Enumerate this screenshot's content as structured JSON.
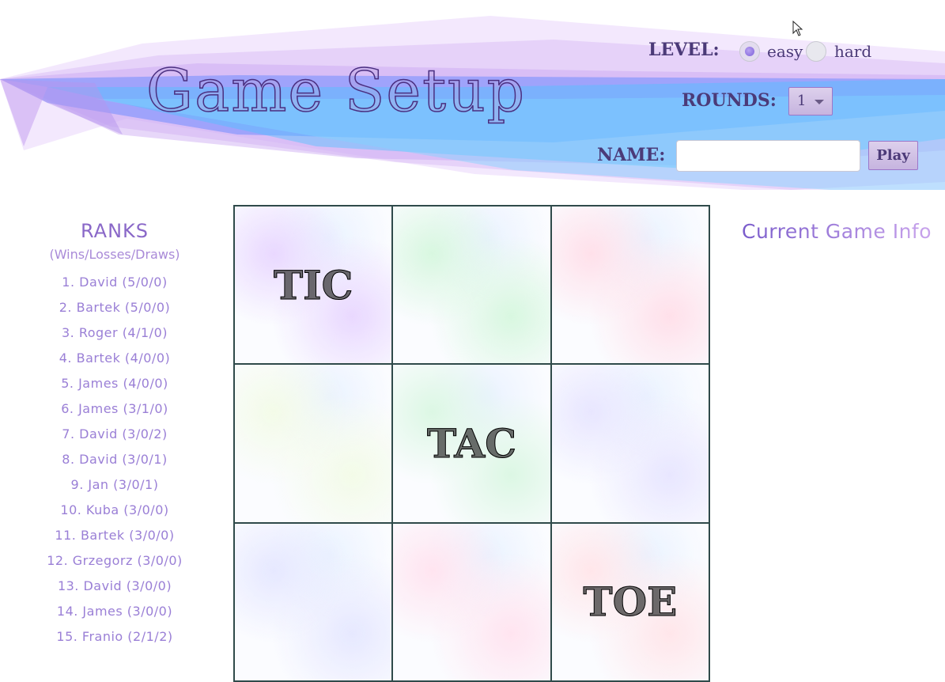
{
  "header": {
    "title": "Game Setup",
    "level_label": "LEVEL:",
    "level_options": [
      "easy",
      "hard"
    ],
    "level_selected": "easy",
    "rounds_label": "ROUNDS:",
    "rounds_value": "1",
    "name_label": "NAME:",
    "name_value": "",
    "play_label": "Play"
  },
  "ranks": {
    "title": "RANKS",
    "subtitle": "(Wins/Losses/Draws)",
    "items": [
      "1. David (5/0/0)",
      "2. Bartek (5/0/0)",
      "3. Roger (4/1/0)",
      "4. Bartek (4/0/0)",
      "5. James (4/0/0)",
      "6. James (3/1/0)",
      "7. David (3/0/2)",
      "8. David (3/0/1)",
      "9. Jan (3/0/1)",
      "10. Kuba (3/0/0)",
      "11. Bartek (3/0/0)",
      "12. Grzegorz (3/0/0)",
      "13. David (3/0/0)",
      "14. James (3/0/0)",
      "15. Franio (2/1/2)"
    ]
  },
  "board": {
    "cells": [
      "TIC",
      "",
      "",
      "",
      "TAC",
      "",
      "",
      "",
      "TOE"
    ],
    "tints": [
      "#e9d8ff",
      "#d8f7e0",
      "#ffe0ea",
      "#f3fbe8",
      "#dcf7e4",
      "#e8e6ff",
      "#e6e8ff",
      "#ffe4f0",
      "#ffe6ea"
    ]
  },
  "info": {
    "title": "Current Game Info"
  },
  "colors": {
    "accent": "#7a5ccb",
    "text": "#4b3a78",
    "grid": "#2f4a4a"
  }
}
